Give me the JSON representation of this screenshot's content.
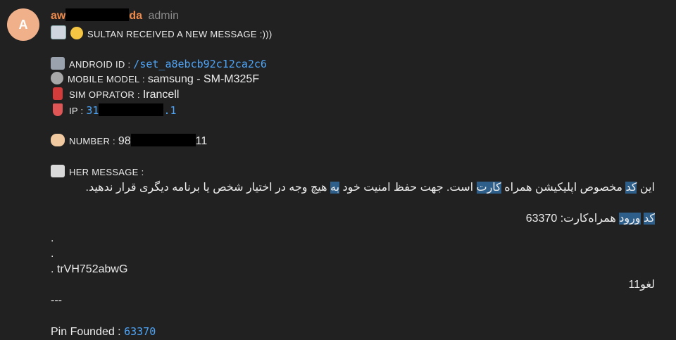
{
  "avatar": {
    "initial": "A",
    "color": "#f0b08a"
  },
  "header": {
    "sender_start": "aw",
    "sender_end": "da",
    "role": "admin"
  },
  "lines": {
    "title": "SULTAN RECEIVED A NEW MESSAGE :)))",
    "android_label": "ANDROID ID : ",
    "android_value": "/set_a8ebcb92c12ca2c6",
    "model_label": "MOBILE MODEL : ",
    "model_value": "samsung - SM-M325F",
    "sim_label": "SIM OPRATOR : ",
    "sim_value": "Irancell",
    "ip_label": "IP : ",
    "ip_start": "31",
    "ip_end": ".1",
    "number_label": "NUMBER : ",
    "number_start": "98",
    "number_end": "11",
    "her_message_label": "HER MESSAGE :",
    "rtl_1_a": "این ",
    "rtl_1_hl1": "کد",
    "rtl_1_b": " مخصوص اپلیکیشن همراه ",
    "rtl_1_hl2": "کارت",
    "rtl_1_c": " است. جهت حفظ امنیت خود ",
    "rtl_1_hl3": "به",
    "rtl_1_d": " هیچ وجه در اختیار شخص یا برنامه دیگری قرار ندهید.",
    "rtl_2_hl1": "کد",
    "rtl_2_hl2": "ورود",
    "rtl_2_rest": " همراه‌کارت: 63370",
    "dot1": ".",
    "dot2": ".",
    "code_line": ". trVH752abwG",
    "rtl_3": "لغو11",
    "separator": "---",
    "pin_label": "Pin Founded : ",
    "pin_value": "63370"
  },
  "icons": [
    "incoming-envelope-icon",
    "face-with-tear-icon",
    "control-knobs-icon",
    "gear-icon",
    "sim-card-icon",
    "bolt-shield-icon",
    "writing-hand-icon",
    "page-icon"
  ],
  "colors": {
    "link": "#4ea4f6",
    "sender": "#f08a4b",
    "highlight": "#2e5f8a"
  }
}
